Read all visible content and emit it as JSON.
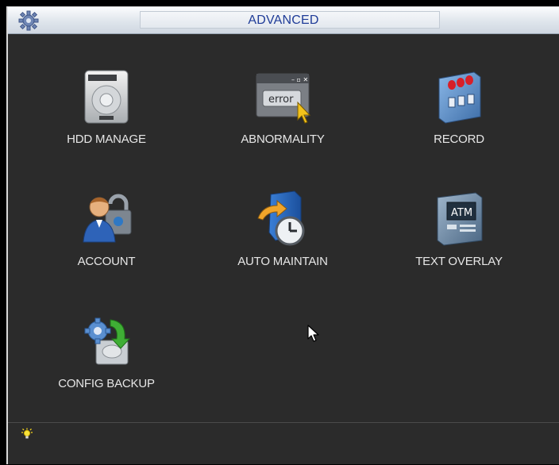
{
  "window": {
    "title": "ADVANCED"
  },
  "menu": {
    "items": [
      {
        "label": "HDD MANAGE",
        "icon": "hdd-icon"
      },
      {
        "label": "ABNORMALITY",
        "icon": "error-window-icon"
      },
      {
        "label": "RECORD",
        "icon": "record-icon"
      },
      {
        "label": "ACCOUNT",
        "icon": "account-lock-icon"
      },
      {
        "label": "AUTO MAINTAIN",
        "icon": "auto-maintain-clock-icon"
      },
      {
        "label": "TEXT OVERLAY",
        "icon": "atm-icon"
      },
      {
        "label": "CONFIG BACKUP",
        "icon": "config-backup-icon"
      }
    ]
  },
  "icon_text": {
    "error_word": "error",
    "atm_word": "ATM"
  },
  "status": {
    "tip_icon": "lightbulb-icon"
  },
  "colors": {
    "background": "#2b2b2b",
    "title_text": "#1f3c98",
    "label_text": "#e6e6e6"
  }
}
